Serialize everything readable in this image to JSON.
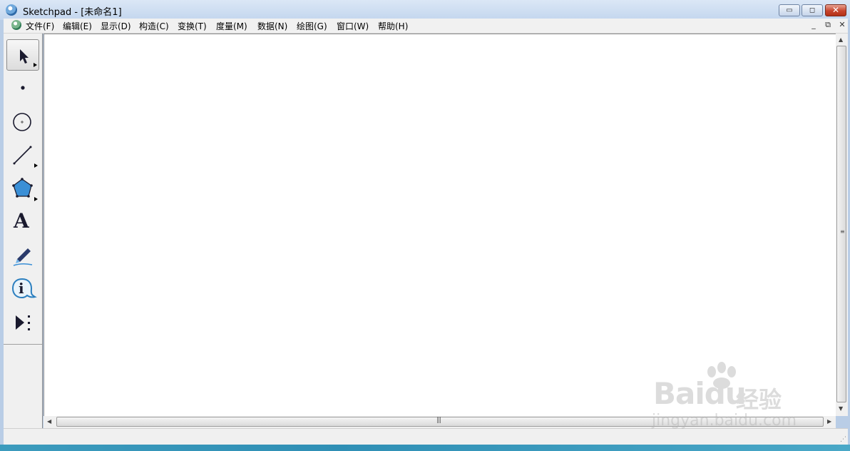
{
  "window": {
    "app_name": "Sketchpad",
    "doc_title": " - [未命名1]",
    "minimize_glyph": "▭",
    "maximize_glyph": "◻",
    "close_glyph": "✕"
  },
  "menu": {
    "items": [
      "文件(F)",
      "编辑(E)",
      "显示(D)",
      "构造(C)",
      "变换(T)",
      "度量(M)",
      "数据(N)",
      "绘图(G)",
      "窗口(W)",
      "帮助(H)"
    ],
    "mdi_minimize": "_",
    "mdi_restore": "⧉",
    "mdi_close": "✕"
  },
  "toolbox": {
    "tools": [
      {
        "name": "selection-arrow-tool",
        "active": true
      },
      {
        "name": "point-tool"
      },
      {
        "name": "compass-tool"
      },
      {
        "name": "straightedge-tool"
      },
      {
        "name": "polygon-tool"
      },
      {
        "name": "text-tool",
        "glyph": "A"
      },
      {
        "name": "marker-tool"
      },
      {
        "name": "information-tool",
        "glyph": "i"
      },
      {
        "name": "custom-tools"
      }
    ]
  },
  "scrollbars": {
    "up": "▲",
    "down": "▼",
    "left": "◀",
    "right": "▶",
    "h_grip": "|||",
    "v_grip": "≡"
  },
  "watermark": {
    "brand": "Baidu",
    "cn": "经验",
    "url": "jingyan.baidu.com"
  },
  "colors": {
    "titlebar": "#c3d6ee",
    "canvas": "#ffffff",
    "polygon_fill": "#3a8fd6",
    "taskbar": "#2f8fb5"
  }
}
